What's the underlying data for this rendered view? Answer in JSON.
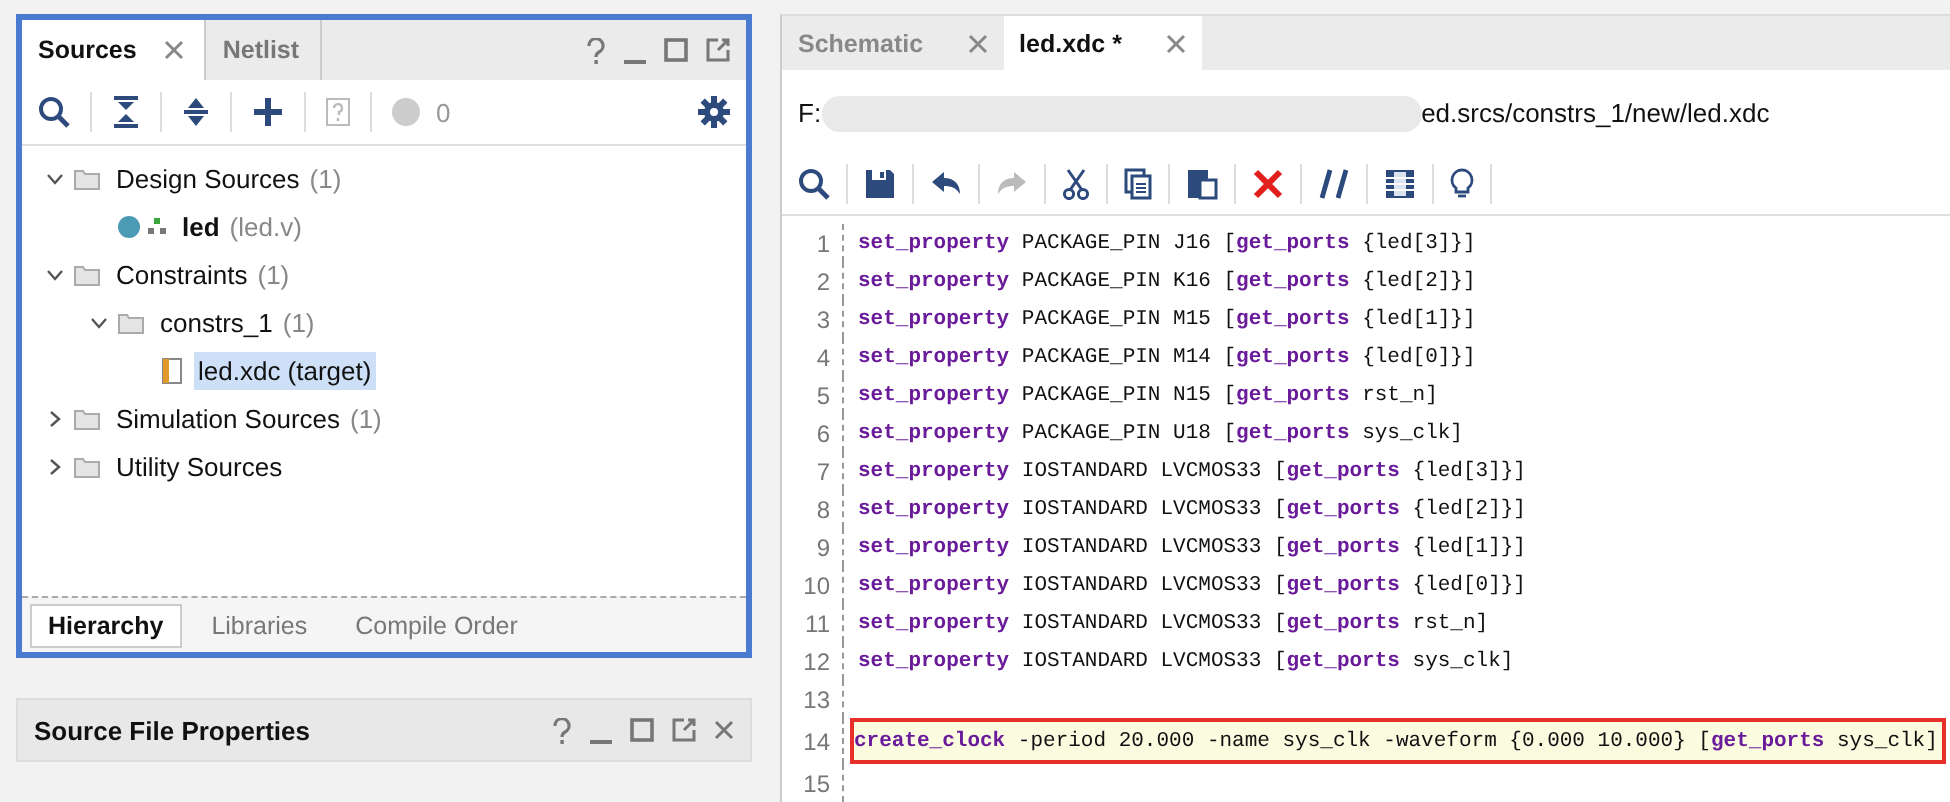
{
  "sources_panel": {
    "tabs": [
      {
        "label": "Sources",
        "selected": true,
        "closable": true
      },
      {
        "label": "Netlist",
        "selected": false,
        "closable": false
      }
    ],
    "status_count": "0",
    "tree": [
      {
        "label": "Design Sources",
        "count": "(1)",
        "kind": "folder",
        "expanded": true,
        "selected": false,
        "children": [
          {
            "label": "led",
            "count": "(led.v)",
            "kind": "module",
            "selected": false
          }
        ]
      },
      {
        "label": "Constraints",
        "count": "(1)",
        "kind": "folder",
        "expanded": true,
        "selected": false,
        "children": [
          {
            "label": "constrs_1",
            "count": "(1)",
            "kind": "folder",
            "expanded": true,
            "selected": false,
            "children": [
              {
                "label": "led.xdc (target)",
                "kind": "xdc",
                "selected": true
              }
            ]
          }
        ]
      },
      {
        "label": "Simulation Sources",
        "count": "(1)",
        "kind": "folder",
        "expanded": false,
        "selected": false
      },
      {
        "label": "Utility Sources",
        "kind": "folder",
        "expanded": false,
        "selected": false
      }
    ],
    "bottom_tabs": [
      {
        "label": "Hierarchy",
        "selected": true
      },
      {
        "label": "Libraries",
        "selected": false
      },
      {
        "label": "Compile Order",
        "selected": false
      }
    ]
  },
  "properties_panel": {
    "title": "Source File Properties"
  },
  "editor": {
    "tabs": [
      {
        "label": "Schematic",
        "selected": false
      },
      {
        "label": "led.xdc *",
        "selected": true
      }
    ],
    "path_start": "F:",
    "path_end": "ed.srcs/constrs_1/new/led.xdc",
    "lines": [
      {
        "number": "1",
        "highlighted": false,
        "tokens": [
          {
            "kind": "command",
            "text": "set_property"
          },
          {
            "kind": "plain",
            "text": " PACKAGE_PIN J16 ["
          },
          {
            "kind": "command",
            "text": "get_ports"
          },
          {
            "kind": "plain",
            "text": " {led[3]}]"
          }
        ]
      },
      {
        "number": "2",
        "highlighted": false,
        "tokens": [
          {
            "kind": "command",
            "text": "set_property"
          },
          {
            "kind": "plain",
            "text": " PACKAGE_PIN K16 ["
          },
          {
            "kind": "command",
            "text": "get_ports"
          },
          {
            "kind": "plain",
            "text": " {led[2]}]"
          }
        ]
      },
      {
        "number": "3",
        "highlighted": false,
        "tokens": [
          {
            "kind": "command",
            "text": "set_property"
          },
          {
            "kind": "plain",
            "text": " PACKAGE_PIN M15 ["
          },
          {
            "kind": "command",
            "text": "get_ports"
          },
          {
            "kind": "plain",
            "text": " {led[1]}]"
          }
        ]
      },
      {
        "number": "4",
        "highlighted": false,
        "tokens": [
          {
            "kind": "command",
            "text": "set_property"
          },
          {
            "kind": "plain",
            "text": " PACKAGE_PIN M14 ["
          },
          {
            "kind": "command",
            "text": "get_ports"
          },
          {
            "kind": "plain",
            "text": " {led[0]}]"
          }
        ]
      },
      {
        "number": "5",
        "highlighted": false,
        "tokens": [
          {
            "kind": "command",
            "text": "set_property"
          },
          {
            "kind": "plain",
            "text": " PACKAGE_PIN N15 ["
          },
          {
            "kind": "command",
            "text": "get_ports"
          },
          {
            "kind": "plain",
            "text": " rst_n]"
          }
        ]
      },
      {
        "number": "6",
        "highlighted": false,
        "tokens": [
          {
            "kind": "command",
            "text": "set_property"
          },
          {
            "kind": "plain",
            "text": " PACKAGE_PIN U18 ["
          },
          {
            "kind": "command",
            "text": "get_ports"
          },
          {
            "kind": "plain",
            "text": " sys_clk]"
          }
        ]
      },
      {
        "number": "7",
        "highlighted": false,
        "tokens": [
          {
            "kind": "command",
            "text": "set_property"
          },
          {
            "kind": "plain",
            "text": " IOSTANDARD LVCMOS33 ["
          },
          {
            "kind": "command",
            "text": "get_ports"
          },
          {
            "kind": "plain",
            "text": " {led[3]}]"
          }
        ]
      },
      {
        "number": "8",
        "highlighted": false,
        "tokens": [
          {
            "kind": "command",
            "text": "set_property"
          },
          {
            "kind": "plain",
            "text": " IOSTANDARD LVCMOS33 ["
          },
          {
            "kind": "command",
            "text": "get_ports"
          },
          {
            "kind": "plain",
            "text": " {led[2]}]"
          }
        ]
      },
      {
        "number": "9",
        "highlighted": false,
        "tokens": [
          {
            "kind": "command",
            "text": "set_property"
          },
          {
            "kind": "plain",
            "text": " IOSTANDARD LVCMOS33 ["
          },
          {
            "kind": "command",
            "text": "get_ports"
          },
          {
            "kind": "plain",
            "text": " {led[1]}]"
          }
        ]
      },
      {
        "number": "10",
        "highlighted": false,
        "tokens": [
          {
            "kind": "command",
            "text": "set_property"
          },
          {
            "kind": "plain",
            "text": " IOSTANDARD LVCMOS33 ["
          },
          {
            "kind": "command",
            "text": "get_ports"
          },
          {
            "kind": "plain",
            "text": " {led[0]}]"
          }
        ]
      },
      {
        "number": "11",
        "highlighted": false,
        "tokens": [
          {
            "kind": "command",
            "text": "set_property"
          },
          {
            "kind": "plain",
            "text": " IOSTANDARD LVCMOS33 ["
          },
          {
            "kind": "command",
            "text": "get_ports"
          },
          {
            "kind": "plain",
            "text": " rst_n]"
          }
        ]
      },
      {
        "number": "12",
        "highlighted": false,
        "tokens": [
          {
            "kind": "command",
            "text": "set_property"
          },
          {
            "kind": "plain",
            "text": " IOSTANDARD LVCMOS33 ["
          },
          {
            "kind": "command",
            "text": "get_ports"
          },
          {
            "kind": "plain",
            "text": " sys_clk]"
          }
        ]
      },
      {
        "number": "13",
        "highlighted": false
      },
      {
        "number": "14",
        "highlighted": true,
        "tokens": [
          {
            "kind": "command",
            "text": "create_clock"
          },
          {
            "kind": "plain",
            "text": " -period 20.000 -name sys_clk -waveform {0.000 10.000} ["
          },
          {
            "kind": "command",
            "text": "get_ports"
          },
          {
            "kind": "plain",
            "text": " sys_clk]"
          }
        ]
      },
      {
        "number": "15",
        "highlighted": false
      }
    ]
  }
}
